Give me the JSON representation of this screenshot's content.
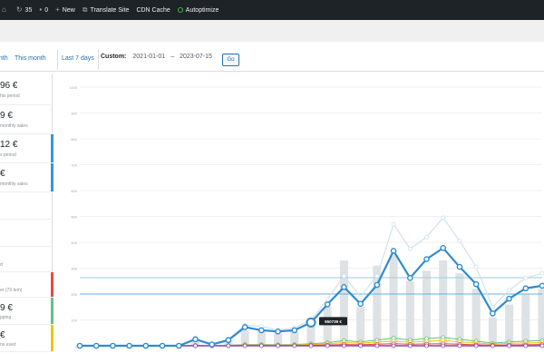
{
  "adminbar": {
    "comments_count": "35",
    "updates_count": "0",
    "new_label": "New",
    "translate_label": "Translate Site",
    "cdn_label": "CDN Cache",
    "autoptimize_label": "Autoptimize",
    "status_color": "#46b450"
  },
  "range_tabs": {
    "month": "onth",
    "this_month": "This month",
    "last_7": "Last 7 days",
    "custom_label": "Custom:",
    "date_from": "2021-01-01",
    "date_separator": "–",
    "date_to": "2023-07-15",
    "go_label": "Go"
  },
  "legend": [
    {
      "value": "96 €",
      "desc": "his period",
      "color": ""
    },
    {
      "value": "9 €",
      "desc": "monthly sales",
      "color": ""
    },
    {
      "value": "12 €",
      "desc": "s period",
      "color": "#3498db"
    },
    {
      "value": "€",
      "desc": "monthly sales",
      "color": "#3498db"
    },
    {
      "value": "",
      "desc": "",
      "color": ""
    },
    {
      "value": "",
      "desc": "",
      "color": ""
    },
    {
      "value": "",
      "desc": "d",
      "color": ""
    },
    {
      "value": "",
      "desc": "er (73 tem)",
      "color": "#e74c3c"
    },
    {
      "value": "9 €",
      "desc": "pping",
      "color": "#5cc488"
    },
    {
      "value": "€",
      "desc": "ns used",
      "color": "#f1c40f"
    }
  ],
  "chart_data": {
    "type": "line",
    "ylim": [
      0,
      1000
    ],
    "y_ticks": [
      "1000",
      "900",
      "800",
      "700",
      "600",
      "500",
      "400",
      "300",
      "200",
      "100",
      "0"
    ],
    "grid": true,
    "avg_line_value": 263,
    "avg_line_secondary": 200,
    "tooltip": {
      "index": 14,
      "label": "950739 €"
    },
    "series": [
      {
        "values": [
          0,
          0,
          0,
          0,
          0,
          0,
          0,
          25,
          5,
          22,
          72,
          60,
          55,
          60,
          90,
          160,
          227,
          162,
          235,
          367,
          262,
          335,
          378,
          305,
          238,
          125,
          182,
          222,
          232
        ],
        "color": "#2e8ccf",
        "width": 2.2
      },
      {
        "values": [
          0,
          0,
          0,
          0,
          0,
          0,
          0,
          30,
          5,
          25,
          80,
          75,
          60,
          70,
          100,
          180,
          270,
          190,
          270,
          470,
          375,
          420,
          495,
          405,
          305,
          150,
          215,
          262,
          280
        ],
        "color": "#cfe3ee",
        "width": 1.2
      },
      {
        "values": [
          0,
          0,
          0,
          0,
          0,
          0,
          0,
          2,
          0,
          2,
          5,
          5,
          4,
          5,
          8,
          12,
          20,
          15,
          22,
          30,
          22,
          28,
          32,
          25,
          18,
          10,
          15,
          18,
          20
        ],
        "color": "#5cc488",
        "width": 1
      },
      {
        "values": [
          0,
          0,
          0,
          0,
          0,
          0,
          0,
          1,
          0,
          1,
          3,
          3,
          2,
          3,
          5,
          8,
          12,
          10,
          14,
          18,
          14,
          17,
          20,
          15,
          11,
          6,
          9,
          11,
          12
        ],
        "color": "#f1c40f",
        "width": 1
      },
      {
        "values": [
          0,
          0,
          0,
          0,
          0,
          0,
          0,
          0,
          0,
          0,
          1,
          1,
          1,
          1,
          2,
          3,
          5,
          4,
          6,
          8,
          6,
          7,
          8,
          6,
          4,
          2,
          3,
          4,
          5
        ],
        "color": "#e74c3c",
        "width": 1
      },
      {
        "values": [
          0,
          0,
          0,
          0,
          0,
          0,
          0,
          0,
          0,
          0,
          0,
          0,
          0,
          0,
          0,
          0,
          0,
          0,
          0,
          0,
          0,
          0,
          0,
          0,
          0,
          0,
          0,
          0,
          0
        ],
        "color": "#8e44ad",
        "width": 1.5
      }
    ],
    "bars": {
      "values": [
        0,
        0,
        0,
        0,
        0,
        0,
        0,
        20,
        5,
        20,
        60,
        55,
        50,
        55,
        80,
        150,
        330,
        150,
        310,
        350,
        250,
        290,
        330,
        280,
        220,
        110,
        160,
        200,
        220
      ],
      "color": "#dfe2e4"
    }
  }
}
